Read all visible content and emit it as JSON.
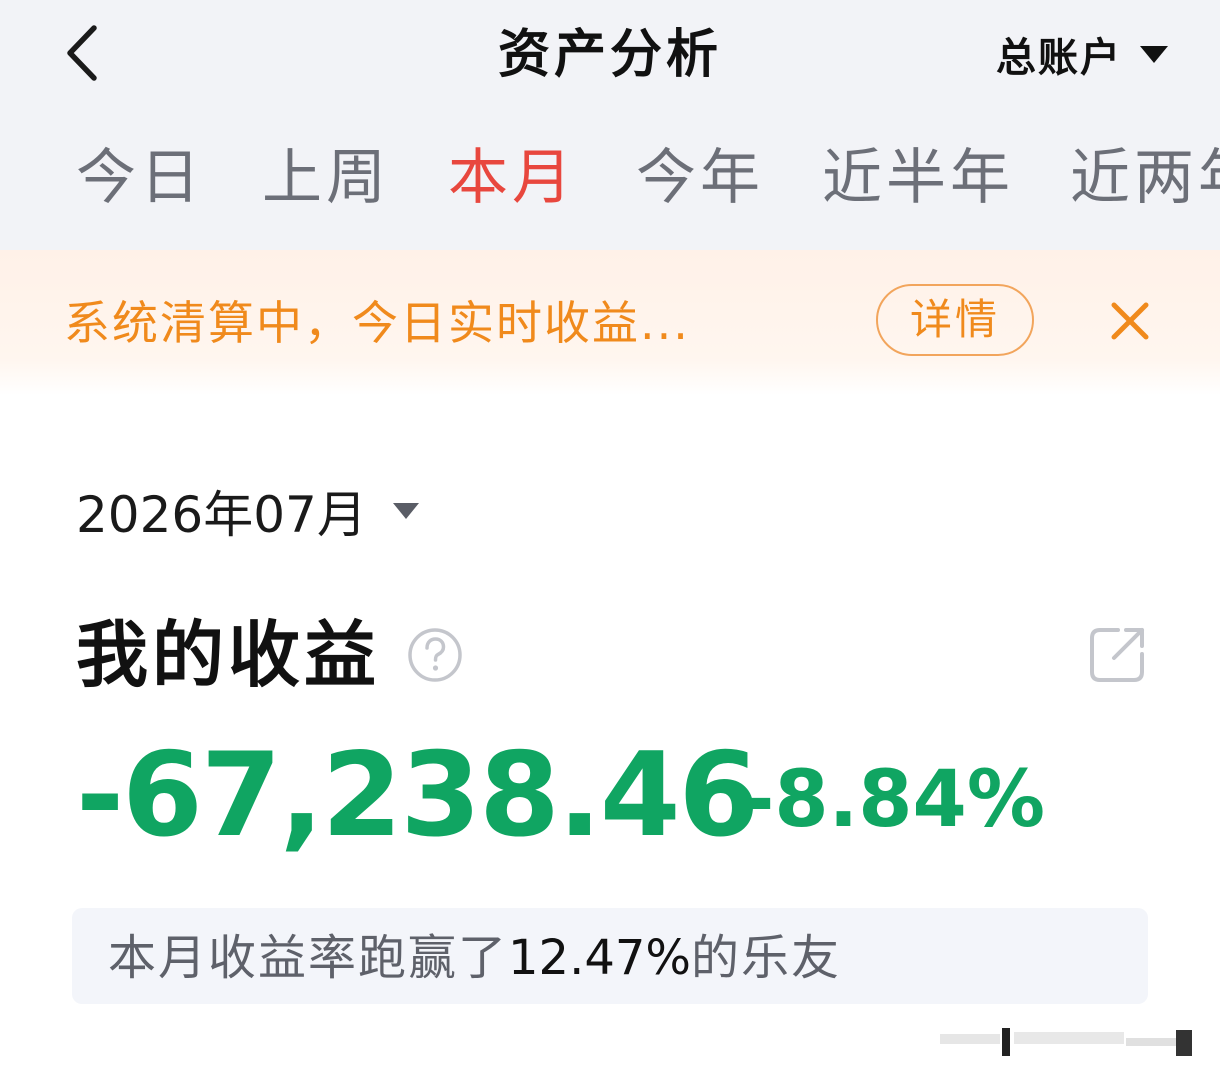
{
  "header": {
    "title": "资产分析",
    "account": "总账户"
  },
  "tabs": [
    {
      "label": "今日",
      "active": false
    },
    {
      "label": "上周",
      "active": false
    },
    {
      "label": "本月",
      "active": true
    },
    {
      "label": "今年",
      "active": false
    },
    {
      "label": "近半年",
      "active": false
    },
    {
      "label": "近两年",
      "active": false
    }
  ],
  "notice": {
    "text": "系统清算中，今日实时收益...",
    "detail_label": "详情"
  },
  "period": {
    "month": "2026年07月"
  },
  "income": {
    "title": "我的收益",
    "amount": "-67,238.46",
    "rate": "-8.84%"
  },
  "ranking": {
    "prefix": "本月收益率跑赢了",
    "percent": "12.47%",
    "suffix": "的乐友"
  },
  "colors": {
    "accent_red": "#e8473e",
    "loss_green": "#10a562",
    "notice_orange": "#f08a1c",
    "header_bg": "#f2f3f7",
    "notice_bg": "#fff1e8"
  },
  "icons": {
    "back": "chevron-left-icon",
    "account_dropdown": "caret-down-icon",
    "notice_close": "close-icon",
    "month_dropdown": "caret-down-icon",
    "help": "question-circle-icon",
    "share": "share-external-icon"
  }
}
